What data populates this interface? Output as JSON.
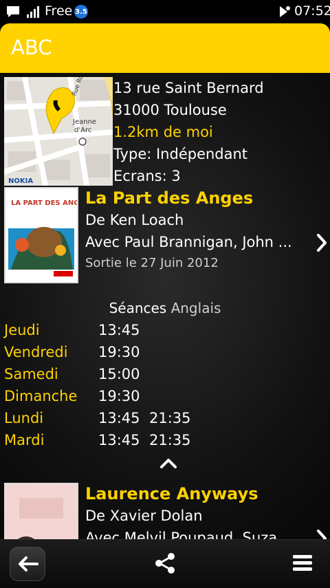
{
  "status_bar": {
    "carrier": "Free",
    "network_badge": "3.5",
    "time": "07:52",
    "icons": [
      "signal-icon",
      "notification-icon"
    ]
  },
  "header": {
    "title": "ABC"
  },
  "cinema": {
    "address_line1": "13 rue Saint Bernard",
    "address_line2": "31000 Toulouse",
    "distance": "1.2km de moi",
    "type": "Type: Indépendant",
    "screens": "Ecrans: 3",
    "map": {
      "street_label": "Rue Roque",
      "place_label_1": "Jeanne",
      "place_label_2": "d'Arc",
      "logo": "NOKIA"
    }
  },
  "movies": [
    {
      "title": "La Part des Anges",
      "director": "De Ken Loach",
      "cast": "Avec Paul Brannigan, John ...",
      "release": "Sortie le 27 Juin 2012",
      "poster_text": "LA PART DES ANGES"
    },
    {
      "title": "Laurence Anyways",
      "director": "De Xavier Dolan",
      "cast": "Avec Melvil Poupaud, Suza..."
    }
  ],
  "showtimes": {
    "heading": "Séances",
    "language": "Anglais",
    "days": [
      {
        "day": "Jeudi",
        "times": [
          "13:45"
        ]
      },
      {
        "day": "Vendredi",
        "times": [
          "19:30"
        ]
      },
      {
        "day": "Samedi",
        "times": [
          "15:00"
        ]
      },
      {
        "day": "Dimanche",
        "times": [
          "19:30"
        ]
      },
      {
        "day": "Lundi",
        "times": [
          "13:45",
          "21:35"
        ]
      },
      {
        "day": "Mardi",
        "times": [
          "13:45",
          "21:35"
        ]
      }
    ]
  },
  "toolbar": {
    "icons": [
      "back-arrow-icon",
      "share-icon",
      "menu-icon"
    ]
  },
  "colors": {
    "accent": "#ffd200",
    "background": "#000000"
  }
}
